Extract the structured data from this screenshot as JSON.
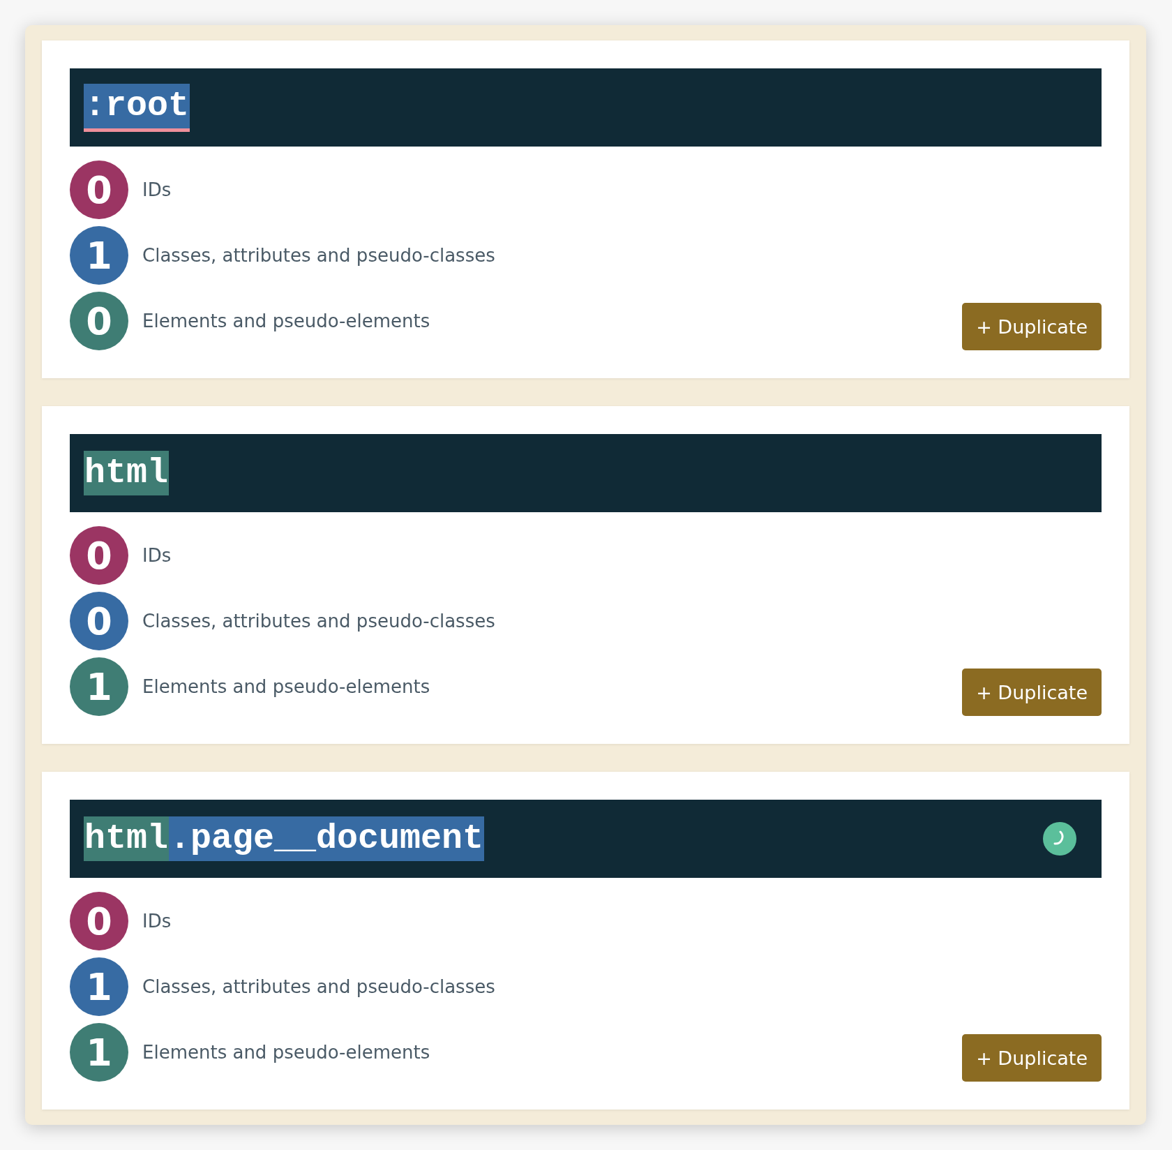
{
  "cards": [
    {
      "selector": [
        {
          "text": ":root",
          "kind": "class",
          "underlined": true
        }
      ],
      "loading": false,
      "counts": [
        {
          "kind": "ids",
          "value": "0",
          "label": "IDs"
        },
        {
          "kind": "classes",
          "value": "1",
          "label": "Classes, attributes and pseudo-classes"
        },
        {
          "kind": "elements",
          "value": "0",
          "label": "Elements and pseudo-elements"
        }
      ],
      "button": "+ Duplicate"
    },
    {
      "selector": [
        {
          "text": "html",
          "kind": "element",
          "underlined": false
        }
      ],
      "loading": false,
      "counts": [
        {
          "kind": "ids",
          "value": "0",
          "label": "IDs"
        },
        {
          "kind": "classes",
          "value": "0",
          "label": "Classes, attributes and pseudo-classes"
        },
        {
          "kind": "elements",
          "value": "1",
          "label": "Elements and pseudo-elements"
        }
      ],
      "button": "+ Duplicate"
    },
    {
      "selector": [
        {
          "text": "html",
          "kind": "element",
          "underlined": false
        },
        {
          "text": ".page__document",
          "kind": "class",
          "underlined": false
        }
      ],
      "loading": true,
      "counts": [
        {
          "kind": "ids",
          "value": "0",
          "label": "IDs"
        },
        {
          "kind": "classes",
          "value": "1",
          "label": "Classes, attributes and pseudo-classes"
        },
        {
          "kind": "elements",
          "value": "1",
          "label": "Elements and pseudo-elements"
        }
      ],
      "button": "+ Duplicate"
    }
  ]
}
